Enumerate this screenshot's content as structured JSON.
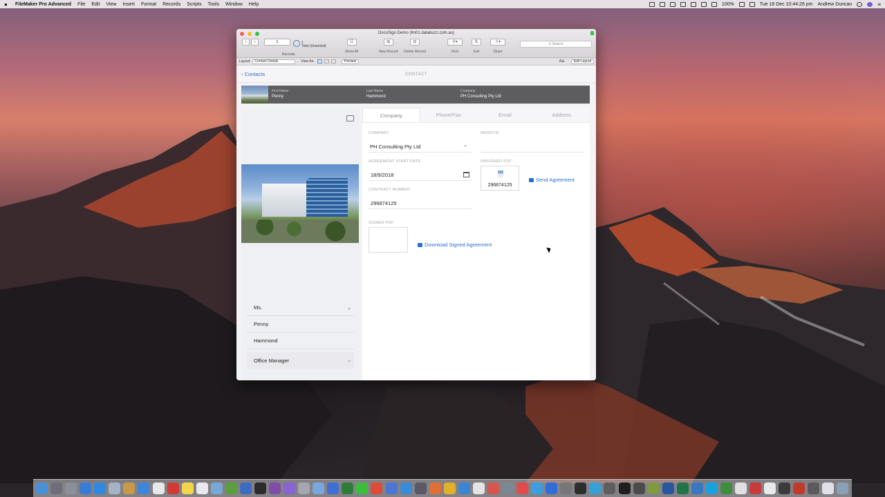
{
  "menubar": {
    "app": "FileMaker Pro Advanced",
    "items": [
      "File",
      "Edit",
      "View",
      "Insert",
      "Format",
      "Records",
      "Scripts",
      "Tools",
      "Window",
      "Help"
    ],
    "battery": "100%",
    "datetime": "Tue 18 Dec  10:44:26 pm",
    "user": "Andrew Duncan"
  },
  "window": {
    "title": "DocuSign Demo (fm01.databuzz.com.au)",
    "toolbar": {
      "record_number": "1",
      "total": "1",
      "total_status": "Total (Unsorted)",
      "records_label": "Records",
      "show_all": "Show All",
      "new_record": "New Record",
      "delete_record": "Delete Record",
      "find": "Find",
      "sort": "Sort",
      "share": "Share",
      "search_placeholder": "Search"
    },
    "layoutbar": {
      "layout_label": "Layout:",
      "layout_value": "Contact Details",
      "view_as": "View As:",
      "preview": "Preview",
      "aa": "Aa",
      "edit_layout": "Edit Layout"
    }
  },
  "nav": {
    "back": "Contacts",
    "title": "CONTACT"
  },
  "header": {
    "first_name_label": "First Name",
    "first_name": "Penny",
    "last_name_label": "Last Name",
    "last_name": "Hammond",
    "company_label": "Company",
    "company": "PH Consulting Pty Ltd"
  },
  "left": {
    "title": "Ms.",
    "first_name": "Penny",
    "last_name": "Hammond",
    "job_title": "Office Manager"
  },
  "tabs": [
    "Company",
    "Phone/Fax",
    "Email",
    "Address"
  ],
  "company_tab": {
    "company_label": "COMPANY",
    "company_value": "PH Consulting Pty Ltd",
    "website_label": "WEBSITE",
    "website_value": "",
    "agreement_start_label": "AGREEMENT START DATE",
    "agreement_start_value": "18/9/2018",
    "unsigned_pdf_label": "UNSIGNED PDF",
    "unsigned_pdf_number": "296874125",
    "send_agreement": "Send Agreement",
    "contract_number_label": "CONTRACT NUMBER",
    "contract_number_value": "296874125",
    "signed_pdf_label": "SIGNED PDF",
    "download_signed": "Download Signed Agreement"
  },
  "dock": {
    "icon_colors": [
      "#4a90d9",
      "#6e6e7a",
      "#8a8f99",
      "#3a7bd5",
      "#2d8ae0",
      "#a4b3c8",
      "#c79a4b",
      "#3d86d9",
      "#e8e8e8",
      "#d13b36",
      "#f2d54d",
      "#e8e8ee",
      "#79a7d8",
      "#5a9e3d",
      "#3c6cc1",
      "#2c2c2c",
      "#7f4ca8",
      "#8a63d2",
      "#a6a6b0",
      "#79a6dc",
      "#3d6fd4",
      "#2f7c3a",
      "#3bbf3b",
      "#de4b39",
      "#4b76d2",
      "#3a8bd8",
      "#5a5a66",
      "#df6f35",
      "#e1b12c",
      "#3a86d2",
      "#e4e4e4",
      "#d9534f",
      "#7b8794",
      "#e14b4b",
      "#3c9ee0",
      "#2f6ed9",
      "#777777",
      "#2d2d2d",
      "#36a1d6",
      "#5e5e5e",
      "#1f1f1f",
      "#4b4b4b",
      "#7f9a3f",
      "#29579d",
      "#20744a",
      "#3a78c2",
      "#19a2e0",
      "#3f8e3f",
      "#e0e0e0",
      "#c93a3a",
      "#e9e9e9",
      "#3a3a3a",
      "#c03b2b",
      "#5b5b5b",
      "#e0e0e6",
      "#8aa0b8"
    ]
  }
}
